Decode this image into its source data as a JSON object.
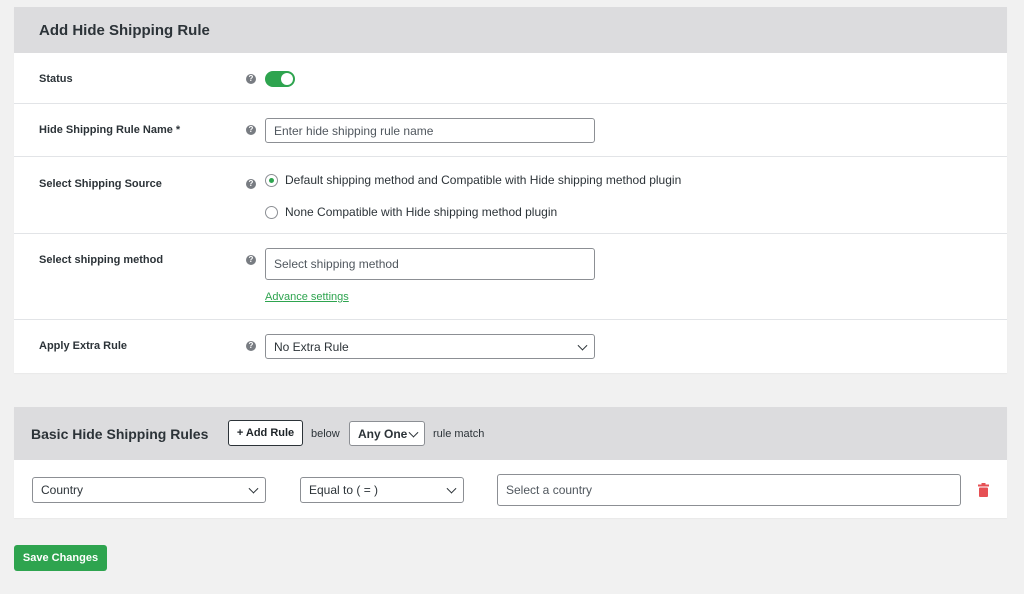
{
  "form": {
    "title": "Add Hide Shipping Rule",
    "status": {
      "label": "Status",
      "enabled": true
    },
    "rule_name": {
      "label": "Hide Shipping Rule Name *",
      "placeholder": "Enter hide shipping rule name",
      "value": ""
    },
    "shipping_source": {
      "label": "Select Shipping Source",
      "options": [
        {
          "label": "Default shipping method and Compatible with Hide shipping method plugin",
          "checked": true
        },
        {
          "label": "None Compatible with Hide shipping method plugin",
          "checked": false
        }
      ]
    },
    "shipping_method": {
      "label": "Select shipping method",
      "placeholder": "Select shipping method",
      "advance_link": "Advance settings"
    },
    "extra_rule": {
      "label": "Apply Extra Rule",
      "selected": "No Extra Rule"
    }
  },
  "rules": {
    "title": "Basic Hide Shipping Rules",
    "add_button": "+ Add Rule",
    "below_text": "below",
    "match_select": "Any One",
    "match_text": "rule match",
    "condition": {
      "field": "Country",
      "operator": "Equal to ( = )",
      "value_placeholder": "Select a country"
    }
  },
  "actions": {
    "save_label": "Save Changes"
  },
  "colors": {
    "accent": "#2ea44f",
    "delete": "#e65054"
  }
}
